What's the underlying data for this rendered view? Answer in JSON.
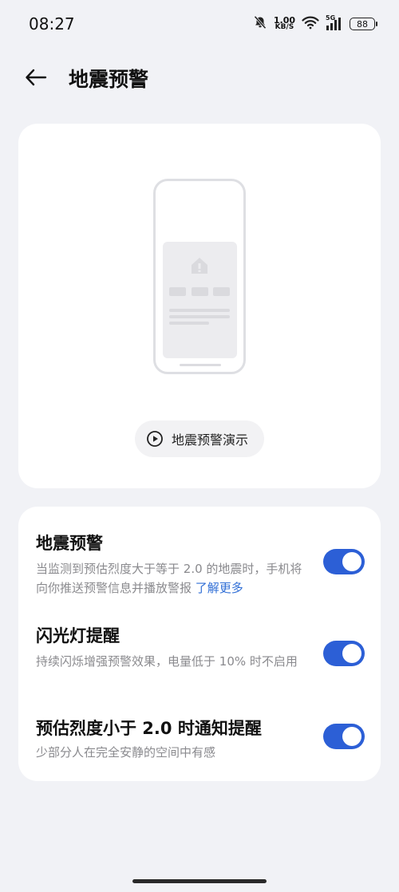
{
  "status": {
    "time": "08:27",
    "speed_value": "1.00",
    "speed_unit": "KB/S",
    "network": "5G",
    "battery": "88"
  },
  "header": {
    "title": "地震预警"
  },
  "demo": {
    "button_label": "地震预警演示"
  },
  "settings": [
    {
      "title": "地震预警",
      "description": "当监测到预估烈度大于等于 2.0 的地震时，手机将向你推送预警信息并播放警报",
      "link": "了解更多",
      "enabled": true
    },
    {
      "title": "闪光灯提醒",
      "description": "持续闪烁增强预警效果，电量低于 10% 时不启用",
      "enabled": true
    },
    {
      "title": "预估烈度小于 2.0 时通知提醒",
      "description": "少部分人在完全安静的空间中有感",
      "enabled": true
    }
  ],
  "colors": {
    "accent": "#2c5fd6",
    "link": "#2f6ed6",
    "background": "#f1f2f6"
  }
}
